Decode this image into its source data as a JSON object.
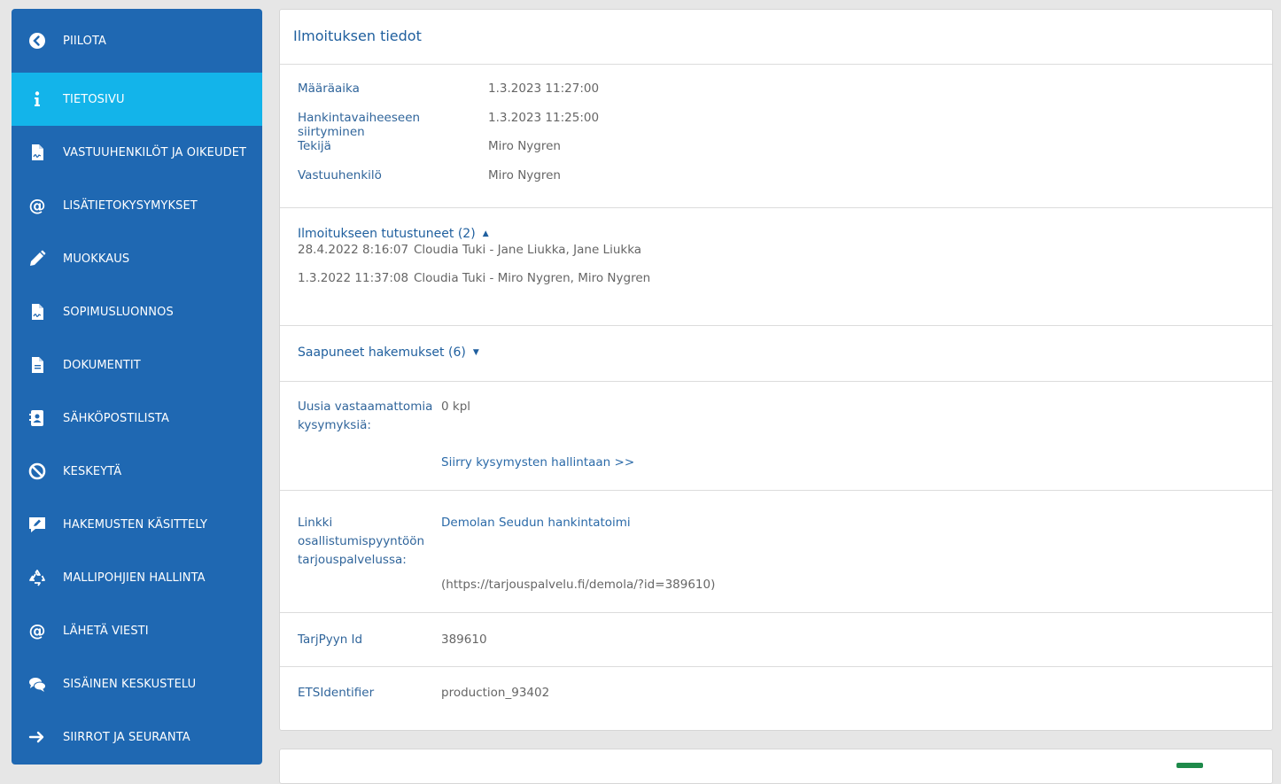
{
  "sidebar": {
    "items": [
      {
        "label": "PIILOTA",
        "icon": "chevron-left-icon"
      },
      {
        "label": "TIETOSIVU",
        "icon": "info-icon"
      },
      {
        "label": "VASTUUHENKILÖT JA OIKEUDET",
        "icon": "signed-document-icon"
      },
      {
        "label": "LISÄTIETOKYSYMYKSET",
        "icon": "at-icon"
      },
      {
        "label": "MUOKKAUS",
        "icon": "pencil-icon"
      },
      {
        "label": "SOPIMUSLUONNOS",
        "icon": "signed-document-icon"
      },
      {
        "label": "DOKUMENTIT",
        "icon": "document-icon"
      },
      {
        "label": "SÄHKÖPOSTILISTA",
        "icon": "contact-card-icon"
      },
      {
        "label": "KESKEYTÄ",
        "icon": "ban-icon"
      },
      {
        "label": "HAKEMUSTEN KÄSITTELY",
        "icon": "comment-edit-icon"
      },
      {
        "label": "MALLIPOHJIEN HALLINTA",
        "icon": "recycle-icon"
      },
      {
        "label": "LÄHETÄ VIESTI",
        "icon": "at-icon"
      },
      {
        "label": "SISÄINEN KESKUSTELU",
        "icon": "chat-bubbles-icon"
      },
      {
        "label": "SIIRROT JA SEURANTA",
        "icon": "arrow-right-icon"
      }
    ],
    "active_index": 1,
    "colors": {
      "background": "#1f68b2",
      "active": "#13b4ea"
    }
  },
  "card": {
    "title": "Ilmoituksen tiedot",
    "details": [
      {
        "label": "Määräaika",
        "value": "1.3.2023 11:27:00"
      },
      {
        "label": "Hankintavaiheeseen siirtyminen",
        "value": "1.3.2023 11:25:00"
      },
      {
        "label": "Tekijä",
        "value": "Miro Nygren"
      },
      {
        "label": "Vastuuhenkilö",
        "value": "Miro Nygren"
      }
    ],
    "viewers": {
      "title": "Ilmoitukseen tutustuneet (2)",
      "rows": [
        {
          "date": "28.4.2022 8:16:07",
          "who": "Cloudia Tuki - Jane Liukka, Jane Liukka"
        },
        {
          "date": "1.3.2022 11:37:08",
          "who": "Cloudia Tuki - Miro Nygren, Miro Nygren"
        }
      ]
    },
    "applications": {
      "title": "Saapuneet hakemukset (6)"
    },
    "questions": {
      "label": "Uusia vastaamattomia kysymyksiä:",
      "value": "0 kpl",
      "link": "Siirry kysymysten hallintaan >>"
    },
    "tender_link": {
      "label": "Linkki osallistumispyyntöön tarjouspalvelussa:",
      "link": "Demolan Seudun hankintatoimi",
      "url": "(https://tarjouspalvelu.fi/demola/?id=389610)"
    },
    "tarjpyyn": {
      "label": "TarjPyyn Id",
      "value": "389610"
    },
    "ets": {
      "label": "ETSIdentifier",
      "value": "production_93402"
    }
  }
}
